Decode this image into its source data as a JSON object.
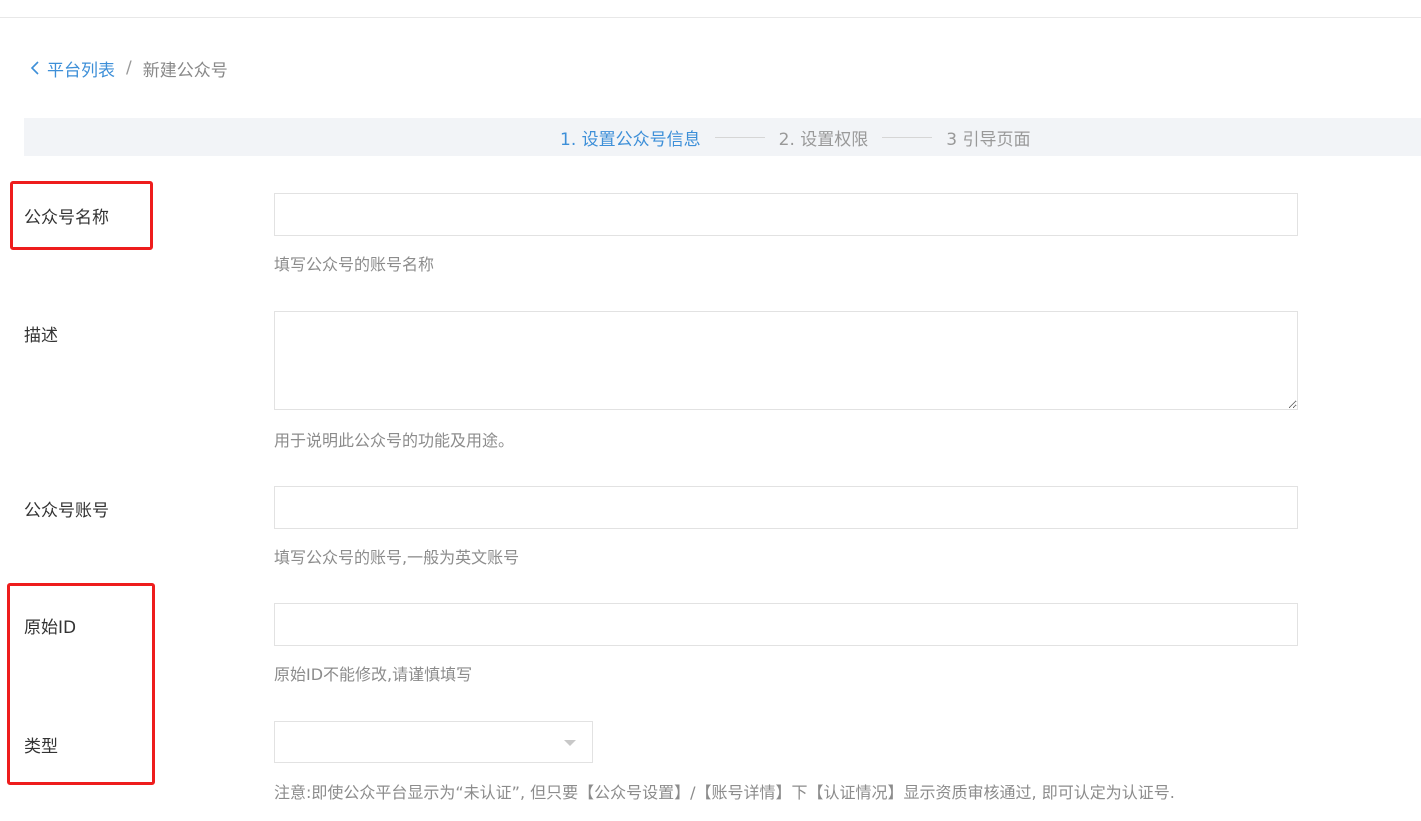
{
  "breadcrumb": {
    "back_label": "平台列表",
    "separator": "/",
    "current": "新建公众号"
  },
  "steps": [
    {
      "label": "1. 设置公众号信息",
      "active": true
    },
    {
      "label": "2. 设置权限",
      "active": false
    },
    {
      "label": "3 引导页面",
      "active": false
    }
  ],
  "form": {
    "name": {
      "label": "公众号名称",
      "value": "",
      "help": "填写公众号的账号名称"
    },
    "description": {
      "label": "描述",
      "value": "",
      "help": "用于说明此公众号的功能及用途。"
    },
    "account": {
      "label": "公众号账号",
      "value": "",
      "help": "填写公众号的账号,一般为英文账号"
    },
    "original_id": {
      "label": "原始ID",
      "value": "",
      "help": "原始ID不能修改,请谨慎填写"
    },
    "type": {
      "label": "类型",
      "value": "",
      "help": "注意:即使公众平台显示为“未认证”, 但只要【公众号设置】/【账号详情】下【认证情况】显示资质审核通过, 即可认定为认证号."
    }
  },
  "colors": {
    "accent": "#3d8fd8",
    "annotation_red": "#ee1d1d",
    "step_bar_bg": "#f2f4f7"
  }
}
